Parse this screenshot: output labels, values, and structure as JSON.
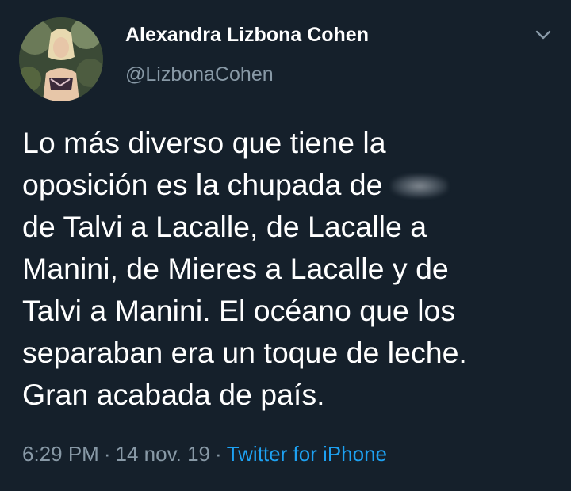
{
  "author": {
    "display_name": "Alexandra Lizbona Cohen",
    "handle": "@LizbonaCohen"
  },
  "tweet": {
    "lines": [
      "Lo más diverso que tiene la",
      "oposición es la chupada de",
      "de Talvi a Lacalle, de Lacalle a",
      "Manini, de Mieres a Lacalle y de",
      "Talvi a Manini. El océano que los",
      "separaban era un toque de leche.",
      "Gran acabada de país."
    ]
  },
  "meta": {
    "time": "6:29 PM",
    "separator": "·",
    "date": "14 nov. 19",
    "source": "Twitter for iPhone"
  },
  "icons": {
    "menu": "chevron-down-icon",
    "avatar": "avatar-photo"
  },
  "colors": {
    "background": "#15202b",
    "text": "#ffffff",
    "secondary": "#8899a6",
    "link": "#1da1f2"
  }
}
